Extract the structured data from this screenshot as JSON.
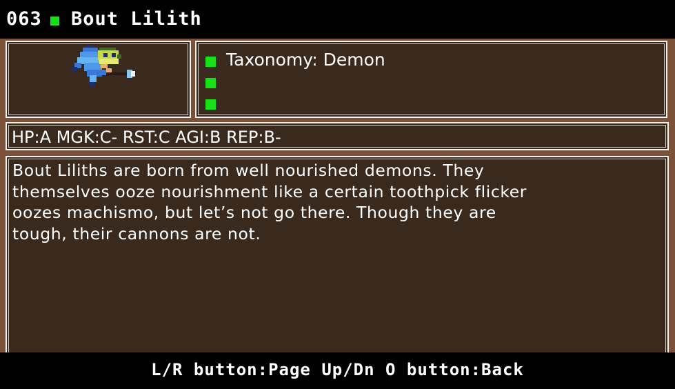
{
  "header": {
    "entry_number": "063",
    "name": "Bout Lilith"
  },
  "sprite": {
    "icon": "bout-lilith-sprite"
  },
  "taxonomy": {
    "lines": [
      "Taxonomy: Demon",
      "",
      ""
    ]
  },
  "stats": {
    "text": "HP:A MGK:C- RST:C AGI:B REP:B-"
  },
  "description": {
    "lines": [
      "Bout Liliths are born from well nourished demons. They",
      "themselves ooze nourishment like a certain toothpick flicker",
      "oozes machismo, but let’s not go there. Though they are",
      "tough, their cannons are not."
    ]
  },
  "footer": {
    "controls": "L/R button:Page Up/Dn O button:Back"
  },
  "colors": {
    "accent_green": "#18e018",
    "board_brown": "#7b5238",
    "panel_dark": "#3a2a1d"
  }
}
